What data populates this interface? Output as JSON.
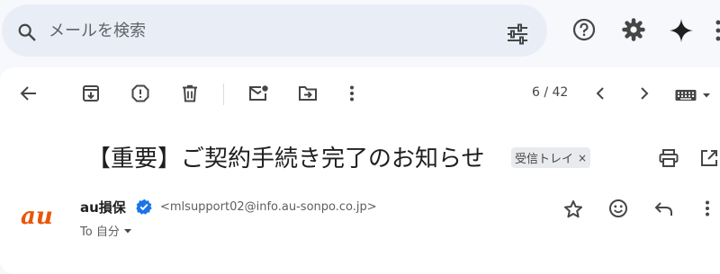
{
  "search": {
    "placeholder": "メールを検索"
  },
  "toolbar": {
    "page_count": "6 / 42"
  },
  "message": {
    "subject": "【重要】ご契約手続き完了のお知らせ",
    "label": "受信トレイ",
    "label_remove": "×",
    "logo_text": "au",
    "logo_color": "#eb5505",
    "sender_name": "au損保",
    "sender_email": "<mlsupport02@info.au-sonpo.co.jp>",
    "recipient": "To 自分"
  },
  "colors": {
    "accent": "#1a73e8",
    "background": "#f6f8fc",
    "search_bg": "#e9eef6"
  }
}
